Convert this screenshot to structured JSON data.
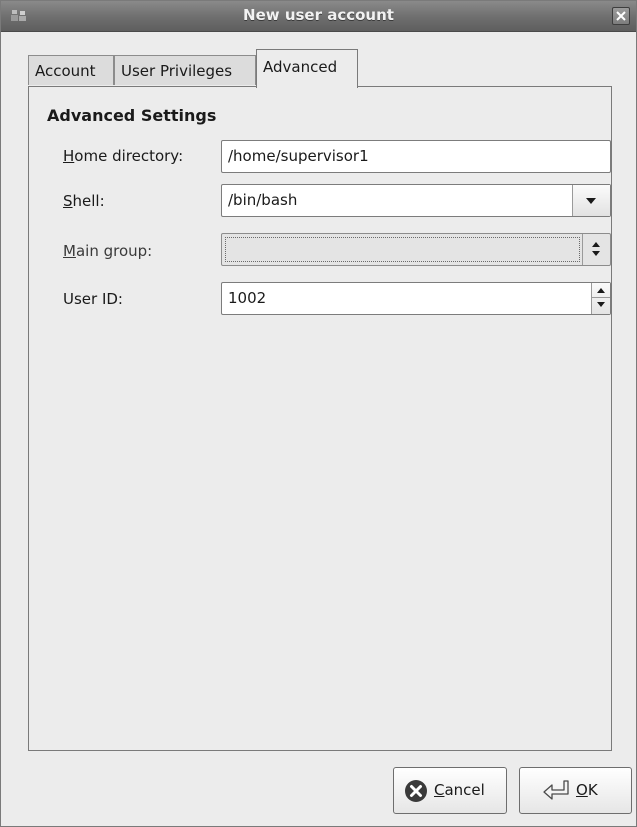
{
  "window": {
    "title": "New user account"
  },
  "tabs": [
    {
      "label": "Account"
    },
    {
      "label": "User Privileges"
    },
    {
      "label": "Advanced",
      "active": true
    }
  ],
  "advanced": {
    "section_title": "Advanced Settings",
    "home_directory": {
      "mnemonic": "H",
      "label_rest": "ome directory:",
      "value": "/home/supervisor1"
    },
    "shell": {
      "mnemonic": "S",
      "label_rest": "hell:",
      "value": "/bin/bash"
    },
    "main_group": {
      "mnemonic": "M",
      "label_rest": "ain group:",
      "value": "",
      "enabled": false
    },
    "user_id": {
      "label": "User ID:",
      "value": "1002"
    }
  },
  "buttons": {
    "cancel": {
      "mnemonic": "C",
      "label_rest": "ancel"
    },
    "ok": {
      "mnemonic": "O",
      "label_rest": "K"
    }
  },
  "icons": {
    "window": "users-icon",
    "close": "close-icon",
    "cancel": "cancel-icon",
    "ok": "ok-icon"
  },
  "colors": {
    "titlebar": "#6e6e6e",
    "window_bg": "#ececec",
    "entry_bg": "#ffffff"
  }
}
